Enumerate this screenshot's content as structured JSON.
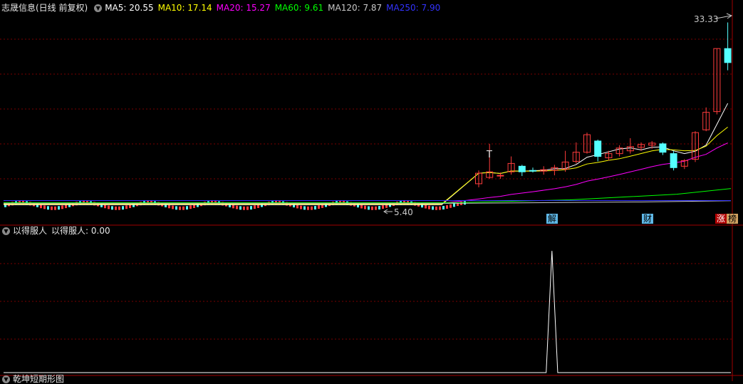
{
  "top_panel": {
    "title": "志晟信息(日线 前复权)",
    "ma_labels": [
      {
        "text": "MA5: 20.55",
        "color": "#ffffff"
      },
      {
        "text": "MA10: 17.14",
        "color": "#ffff00"
      },
      {
        "text": "MA20: 15.27",
        "color": "#ff00ff"
      },
      {
        "text": "MA60: 9.61",
        "color": "#00ff00"
      },
      {
        "text": "MA120: 7.87",
        "color": "#c8c8c8"
      },
      {
        "text": "MA250: 7.90",
        "color": "#3333ff"
      }
    ],
    "high_label": "33.33",
    "low_label": "5.40",
    "t_marker": "T",
    "event_tags": [
      "解",
      "财"
    ],
    "limit_tags": [
      "涨",
      "榜"
    ]
  },
  "bottom_panel": {
    "title": "以得服人",
    "value_label": "以得服人: 0.00"
  },
  "footer_text": "乾坤短期形图",
  "colors": {
    "up": "#ff3c3c",
    "down": "#54ffff",
    "grid": "#7a0000",
    "ma5": "#ffffff",
    "ma10": "#ffff00",
    "ma20": "#ff00ff",
    "ma60": "#00ff00",
    "ma120": "#c8c8c8",
    "ma250": "#3333ff"
  },
  "chart_data": [
    {
      "type": "candlestick",
      "title": "志晟信息(日线 前复权)",
      "y_axis": {
        "min": 5.0,
        "max": 34.5
      },
      "candles": [
        {
          "o": 10.3,
          "h": 12.2,
          "l": 9.8,
          "c": 11.8
        },
        {
          "o": 11.2,
          "h": 16.0,
          "l": 11.0,
          "c": 12.0
        },
        {
          "o": 11.4,
          "h": 11.9,
          "l": 11.0,
          "c": 11.5
        },
        {
          "o": 12.0,
          "h": 14.2,
          "l": 11.6,
          "c": 13.2
        },
        {
          "o": 12.8,
          "h": 13.0,
          "l": 11.4,
          "c": 12.0
        },
        {
          "o": 12.2,
          "h": 12.6,
          "l": 11.9,
          "c": 12.1
        },
        {
          "o": 12.1,
          "h": 12.8,
          "l": 11.6,
          "c": 12.3
        },
        {
          "o": 12.2,
          "h": 13.0,
          "l": 11.5,
          "c": 12.6
        },
        {
          "o": 12.4,
          "h": 15.0,
          "l": 12.0,
          "c": 13.4
        },
        {
          "o": 13.5,
          "h": 16.2,
          "l": 13.2,
          "c": 14.8
        },
        {
          "o": 14.8,
          "h": 17.6,
          "l": 14.6,
          "c": 17.3
        },
        {
          "o": 16.4,
          "h": 16.6,
          "l": 13.5,
          "c": 14.2
        },
        {
          "o": 14.0,
          "h": 15.0,
          "l": 13.6,
          "c": 14.6
        },
        {
          "o": 14.6,
          "h": 15.8,
          "l": 14.2,
          "c": 15.4
        },
        {
          "o": 15.0,
          "h": 16.8,
          "l": 14.6,
          "c": 15.6
        },
        {
          "o": 15.5,
          "h": 16.2,
          "l": 15.0,
          "c": 15.9
        },
        {
          "o": 15.8,
          "h": 16.4,
          "l": 15.3,
          "c": 16.1
        },
        {
          "o": 16.0,
          "h": 16.2,
          "l": 14.4,
          "c": 14.8
        },
        {
          "o": 14.6,
          "h": 15.0,
          "l": 12.2,
          "c": 12.6
        },
        {
          "o": 12.8,
          "h": 13.8,
          "l": 12.4,
          "c": 13.6
        },
        {
          "o": 13.8,
          "h": 17.8,
          "l": 13.4,
          "c": 17.6
        },
        {
          "o": 18.0,
          "h": 21.2,
          "l": 17.8,
          "c": 20.5
        },
        {
          "o": 20.6,
          "h": 29.6,
          "l": 20.2,
          "c": 29.6
        },
        {
          "o": 29.6,
          "h": 33.33,
          "l": 26.5,
          "c": 27.6
        }
      ]
    },
    {
      "type": "line",
      "title": "以得服人",
      "series": [
        {
          "values": [
            0,
            0,
            0,
            0,
            0,
            0,
            0,
            0,
            0,
            0,
            0,
            0,
            0,
            0,
            0,
            0,
            0,
            0,
            0,
            0,
            0,
            0,
            0,
            0,
            0,
            0,
            0,
            0,
            0,
            0,
            0,
            0,
            0,
            0,
            0,
            0,
            0,
            0,
            0,
            0,
            0,
            0,
            0,
            0,
            0,
            0,
            0,
            0,
            0,
            0,
            0,
            0,
            0,
            0,
            0,
            0,
            0,
            0,
            0,
            0,
            0,
            0,
            0,
            0,
            0,
            0,
            0,
            0,
            0,
            0,
            0,
            0,
            0,
            0,
            0,
            0,
            0,
            0,
            0,
            0,
            0,
            0,
            0,
            0,
            0,
            0,
            0,
            0,
            0,
            0,
            0,
            0,
            0,
            0,
            0,
            1,
            0,
            0,
            0,
            0,
            0,
            0,
            0,
            0,
            0,
            0,
            0,
            0,
            0,
            0,
            0,
            0,
            0,
            0,
            0,
            0,
            0,
            0,
            0,
            0,
            0,
            0,
            0,
            0,
            0,
            0,
            0
          ]
        }
      ],
      "y_axis": {
        "min": 0,
        "max": 1.1
      }
    }
  ]
}
